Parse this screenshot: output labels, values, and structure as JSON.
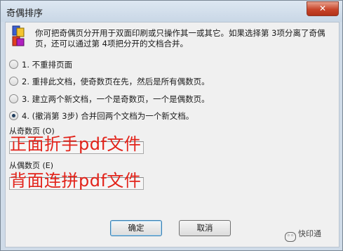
{
  "window": {
    "title": "奇偶排序",
    "close_glyph": "✕"
  },
  "intro": "你可把奇偶页分开用于双面印刷或只操作其一或其它。如果选择第 3项分离了奇偶页，还可以通过第 4项把分开的文档合并。",
  "options": [
    {
      "label": "1. 不重排页面",
      "selected": false
    },
    {
      "label": "2. 重排此文档，使奇数页在先，然后是所有偶数页。",
      "selected": false
    },
    {
      "label": "3. 建立两个新文档，一个是奇数页，一个是偶数页。",
      "selected": false
    },
    {
      "label": "4. (撤消第 3步) 合并回两个文档为一个新文档。",
      "selected": true
    }
  ],
  "odd_section": {
    "label": "从奇数页 (O)",
    "overlay_text": "正面折手pdf文件"
  },
  "even_section": {
    "label": "从偶数页 (E)",
    "overlay_text": "背面连拼pdf文件"
  },
  "buttons": {
    "ok": "确定",
    "cancel": "取消"
  },
  "watermark": {
    "text": "快印通"
  },
  "colors": {
    "overlay_text": "#e2231a",
    "close_button": "#c8452a"
  }
}
